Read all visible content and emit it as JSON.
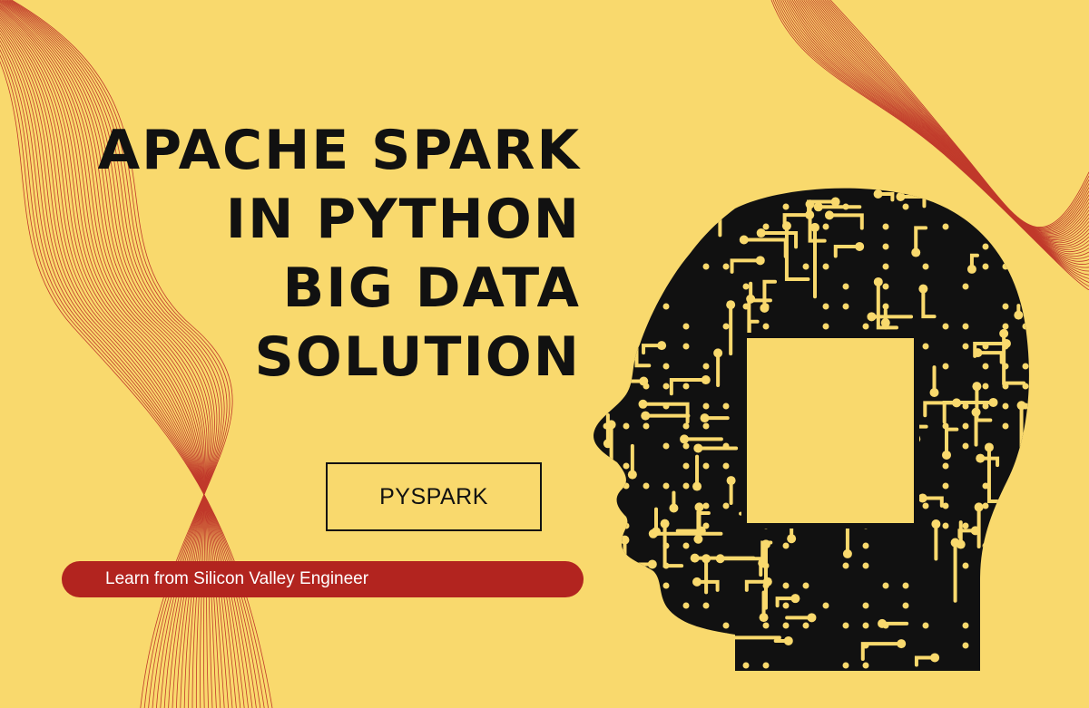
{
  "title": {
    "lines": [
      "APACHE SPARK",
      "IN PYTHON",
      "BIG DATA",
      "SOLUTION"
    ]
  },
  "button": {
    "label": "PYSPARK"
  },
  "tagline": {
    "text": "Learn from Silicon Valley Engineer"
  },
  "illustration": {
    "icon": "circuit-head-icon"
  },
  "colors": {
    "background": "#f9d96d",
    "text": "#111111",
    "accent": "#b2241f",
    "lines": "#c0392b"
  }
}
